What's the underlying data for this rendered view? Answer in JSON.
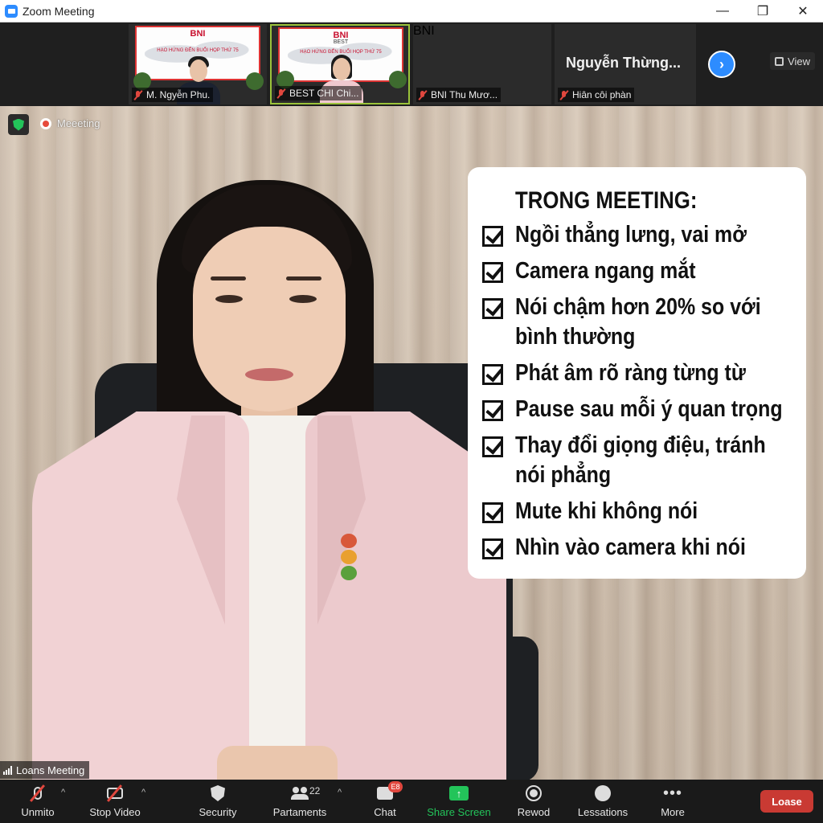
{
  "window": {
    "title": "Zoom Meeting",
    "minimize": "—",
    "maximize": "❐",
    "close": "✕"
  },
  "gallery": {
    "participants": [
      {
        "name": "M. Ngyễn Phu.",
        "slide_brand": "BNI",
        "slide_caption": "HẠO HỨNG ĐẾN BUỔI HỌP THỨ 75"
      },
      {
        "name": "BEST CHI Chi...",
        "slide_brand": "BNI",
        "slide_brand_sub": "BEST",
        "slide_caption": "HẠO HỨNG ĐẾN BUỔI HỌP THỨ 75"
      },
      {
        "name": "BNI Thu Mươ...",
        "logo_text": "BNI"
      },
      {
        "name": "Hiân côi phàn",
        "display_name": "Nguyễn Thừng..."
      }
    ],
    "view_label": "View",
    "next_icon": "chevron-right-icon"
  },
  "meeting": {
    "recording_label": "Meeeting",
    "speaker_label": "Loans Meeting"
  },
  "checklist": {
    "title": "TRONG MEETING:",
    "items": [
      {
        "line1": "Ngồi thẳng lưng, vai mở",
        "line2": ""
      },
      {
        "line1": "Camera ngang mắt",
        "line2": ""
      },
      {
        "line1": "Nói chậm hơn 20% so với",
        "line2": "bình thường"
      },
      {
        "line1": "Phát âm rõ ràng từng từ",
        "line2": ""
      },
      {
        "line1": "Pause sau mỗi ý quan trọng",
        "line2": ""
      },
      {
        "line1": "Thay đổi giọng điệu, tránh",
        "line2": "nói phẳng"
      },
      {
        "line1": "Mute khi không nói",
        "line2": ""
      },
      {
        "line1": "Nhìn vào camera khi nói",
        "line2": ""
      }
    ]
  },
  "toolbar": {
    "unmute": "Unmito",
    "stop_video": "Stop Video",
    "security": "Security",
    "participants": "Partaments",
    "participants_count": "22",
    "chat": "Chat",
    "chat_badge": "E8",
    "share_screen": "Share Screen",
    "record": "Rewod",
    "reactions": "Lessations",
    "more": "More",
    "leave": "Loase",
    "caret": "^"
  },
  "colors": {
    "accent": "#2d8cff",
    "share": "#23c45a",
    "leave": "#c93a33",
    "muted": "#e0473e"
  }
}
